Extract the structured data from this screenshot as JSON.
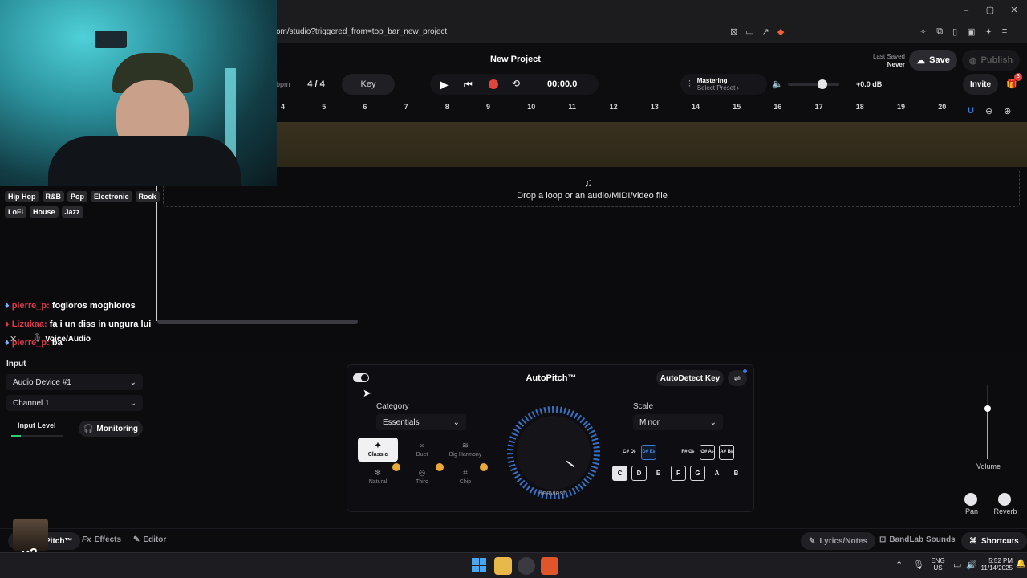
{
  "browser": {
    "url": "om/studio?triggered_from=top_bar_new_project",
    "window_buttons": [
      "–",
      "▢",
      "✕"
    ]
  },
  "header": {
    "project_title": "New Project",
    "bpm_label": "bpm",
    "time_signature": "4 / 4",
    "key_label": "Key",
    "time": "00:00.0",
    "mastering_title": "Mastering",
    "mastering_preset": "Select Preset ›",
    "volume_db": "+0.0 dB",
    "last_saved_label": "Last Saved",
    "last_saved_value": "Never",
    "save_label": "Save",
    "publish_label": "Publish",
    "invite_label": "Invite",
    "notification_count": "3"
  },
  "ruler": {
    "ticks": [
      "4",
      "5",
      "6",
      "7",
      "8",
      "9",
      "10",
      "11",
      "12",
      "13",
      "14",
      "15",
      "16",
      "17",
      "18",
      "19",
      "20"
    ]
  },
  "dropzone": {
    "text": "Drop a loop or an audio/MIDI/video file"
  },
  "chat": {
    "genres_row1": [
      "Hip Hop",
      "R&B",
      "Pop",
      "Electronic",
      "Rock"
    ],
    "genres_row2": [
      "LoFi",
      "House",
      "Jazz"
    ],
    "messages": [
      {
        "user": "pierre_p:",
        "text": "fogioros moghioros",
        "color": "#d83a4a"
      },
      {
        "user": "Lizukaa:",
        "text": "fa i un diss in ungura lui",
        "color": "#d83a4a"
      },
      {
        "user": "pierre_p:",
        "text": "ba",
        "color": "#d83a4a"
      }
    ],
    "gift_count": "x2"
  },
  "panel": {
    "voice_audio_label": "Voice/Audio",
    "input_label": "Input",
    "audio_device": "Audio Device #1",
    "channel": "Channel 1",
    "input_level_label": "Input Level",
    "monitoring_label": "Monitoring",
    "volume_label": "Volume",
    "pan_label": "Pan",
    "reverb_label": "Reverb"
  },
  "autopitch": {
    "title": "AutoPitch™",
    "autodetect_label": "AutoDetect Key",
    "category_label": "Category",
    "category_value": "Essentials",
    "modes": [
      {
        "label": "Classic",
        "active": true
      },
      {
        "label": "Duet",
        "active": false
      },
      {
        "label": "Big Harmony",
        "active": false
      },
      {
        "label": "Natural",
        "active": false
      },
      {
        "label": "Third",
        "active": false
      },
      {
        "label": "Chip",
        "active": false
      }
    ],
    "knob_label": "Heaviest",
    "scale_label": "Scale",
    "scale_value": "Minor",
    "sharp_keys": [
      "C# D♭",
      "D# E♭",
      "F# G♭",
      "G# A♭",
      "A# B♭"
    ],
    "natural_keys": [
      "C",
      "D",
      "E",
      "F",
      "G",
      "A",
      "B"
    ]
  },
  "bottom_tabs": {
    "pitch_label": "Pitch™",
    "effects_label": "Effects",
    "editor_label": "Editor",
    "lyrics_label": "Lyrics/Notes",
    "bandlab_label": "BandLab Sounds",
    "shortcuts_label": "Shortcuts"
  },
  "taskbar": {
    "lang": "ENG",
    "region": "US",
    "time": "5:52 PM",
    "date": "11/14/2025"
  },
  "colors": {
    "accent_blue": "#3d7bd8",
    "record_red": "#e0443a",
    "chat_name_red": "#d83a4a"
  }
}
